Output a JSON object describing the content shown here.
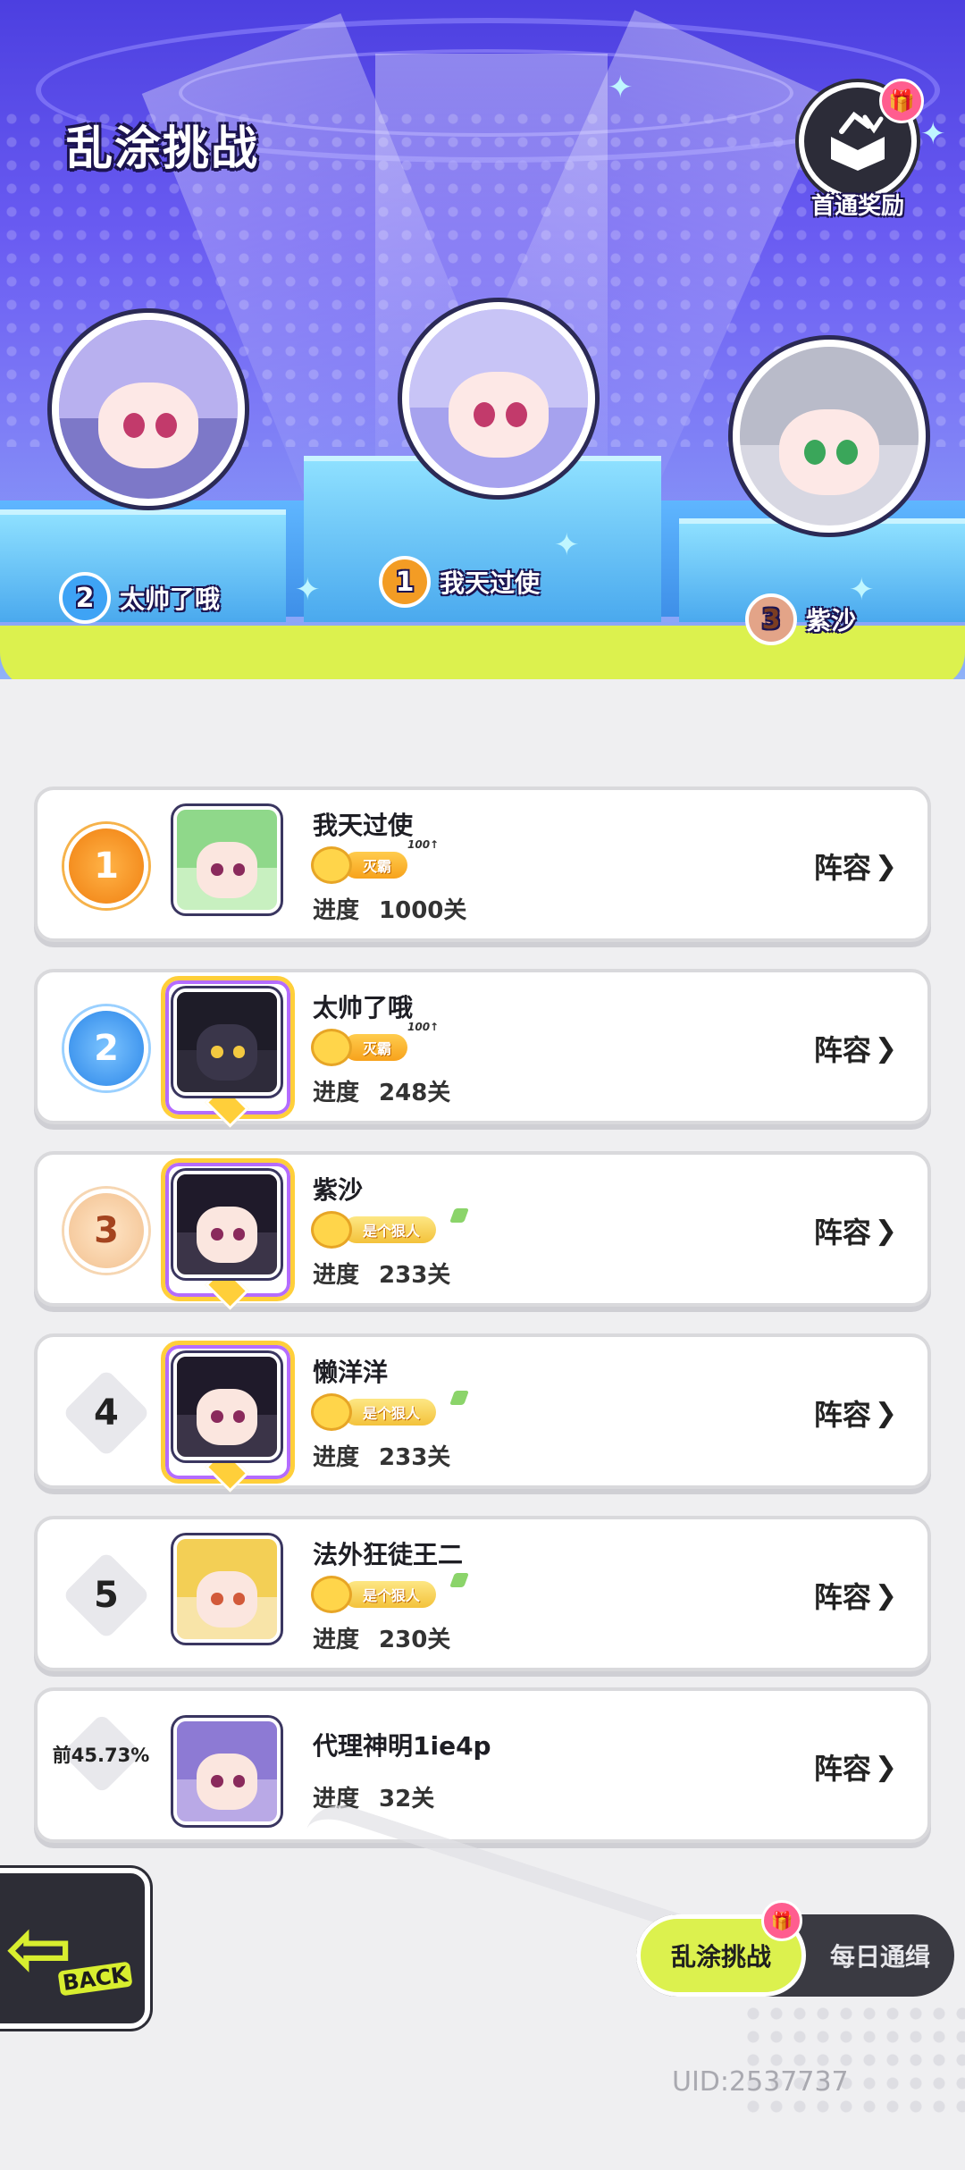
{
  "hero": {
    "title": "乱涂挑战",
    "reward_label": "首通奖励",
    "podium": [
      {
        "rank": "2",
        "name": "太帅了哦"
      },
      {
        "rank": "1",
        "name": "我天过使"
      },
      {
        "rank": "3",
        "name": "紫沙"
      }
    ]
  },
  "leaderboard": [
    {
      "rank": "1",
      "name": "我天过使",
      "badge": "灭霸",
      "badge_tag": "100↑",
      "progress_label": "进度",
      "progress": "1000关",
      "lineup": "阵容"
    },
    {
      "rank": "2",
      "name": "太帅了哦",
      "badge": "灭霸",
      "badge_tag": "100↑",
      "progress_label": "进度",
      "progress": "248关",
      "lineup": "阵容"
    },
    {
      "rank": "3",
      "name": "紫沙",
      "badge": "是个狠人",
      "progress_label": "进度",
      "progress": "233关",
      "lineup": "阵容"
    },
    {
      "rank": "4",
      "name": "懒洋洋",
      "badge": "是个狠人",
      "progress_label": "进度",
      "progress": "233关",
      "lineup": "阵容"
    },
    {
      "rank": "5",
      "name": "法外狂徒王二",
      "badge": "是个狠人",
      "progress_label": "进度",
      "progress": "230关",
      "lineup": "阵容"
    }
  ],
  "self": {
    "percentile": "前45.73%",
    "name": "代理神明1ie4p",
    "progress_label": "进度",
    "progress": "32关",
    "lineup": "阵容"
  },
  "back_label": "BACK",
  "tabs": {
    "active": "乱涂挑战",
    "inactive": "每日通缉"
  },
  "uid": "UID:2537737",
  "icons": {
    "gift": "gift-icon",
    "back": "back-arrow-icon",
    "chevron": "chevron-right-icon"
  },
  "colors": {
    "accent": "#dcf14e",
    "hero_top": "#4c3fe0",
    "gold": "#f39c24"
  }
}
